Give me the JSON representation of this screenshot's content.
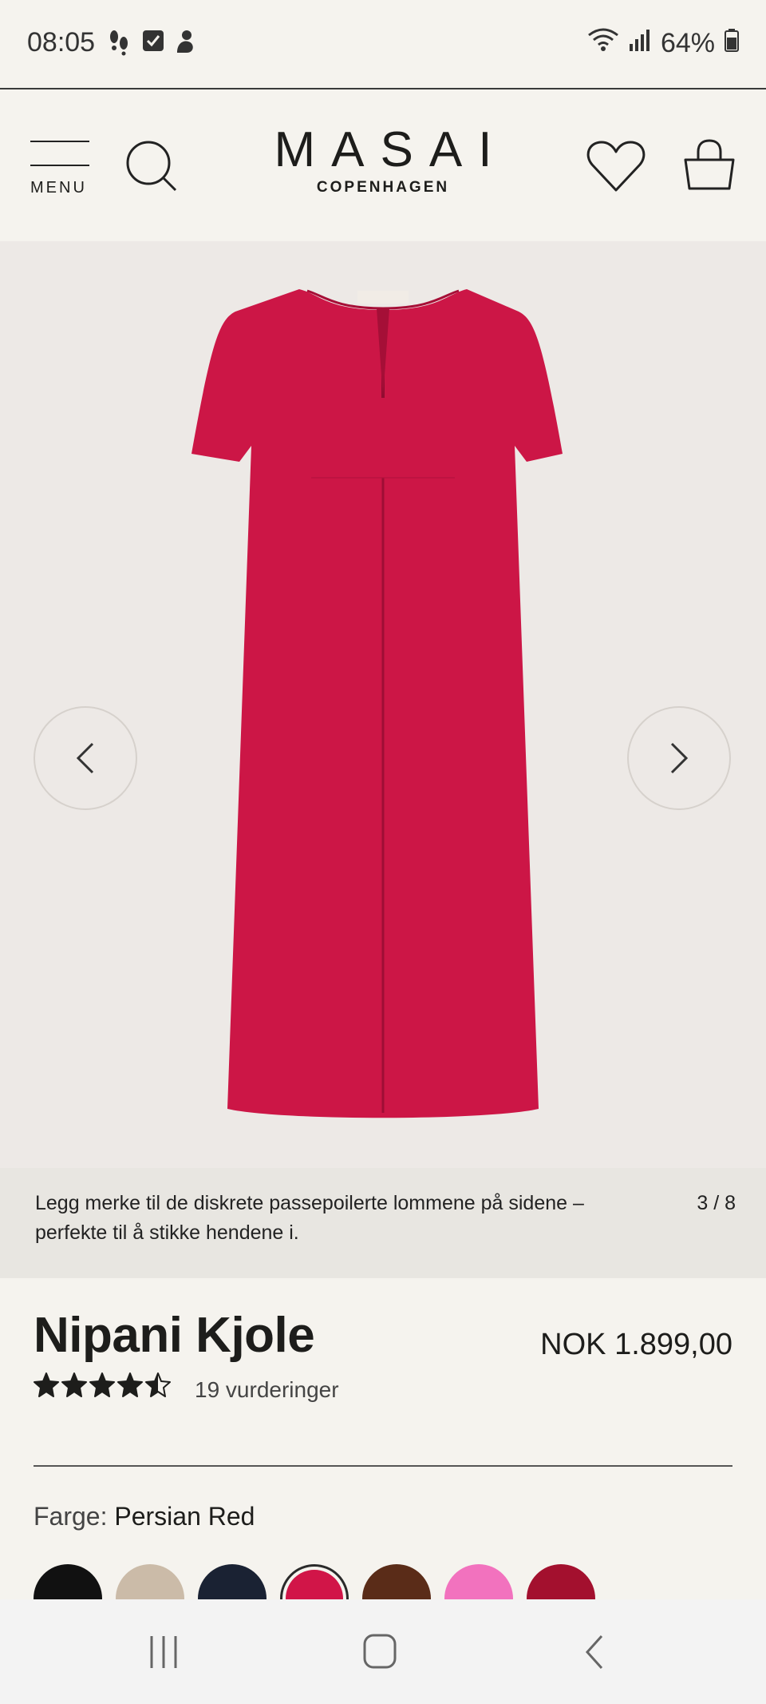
{
  "status_bar": {
    "time": "08:05",
    "battery": "64%"
  },
  "header": {
    "menu_label": "MENU",
    "logo_main": "MASAI",
    "logo_sub": "COPENHAGEN"
  },
  "gallery": {
    "caption": "Legg merke til de diskrete passepoilerte lommene på sidene – perfekte til å stikke hendene i.",
    "counter": "3 / 8",
    "dress_color": "#cc1646"
  },
  "product": {
    "name": "Nipani Kjole",
    "price": "NOK 1.899,00",
    "rating": 4.5,
    "reviews": "19 vurderinger",
    "color_label": "Farge:",
    "color_name": "Persian Red",
    "swatches": [
      {
        "color": "#111111",
        "selected": false
      },
      {
        "color": "#cbbba8",
        "selected": false
      },
      {
        "color": "#1a2233",
        "selected": false
      },
      {
        "color": "#d11548",
        "selected": true
      },
      {
        "color": "#5a2c18",
        "selected": false
      },
      {
        "color": "#f272be",
        "selected": false
      },
      {
        "color": "#a3102e",
        "selected": false
      }
    ]
  },
  "icons": [
    "menu-icon",
    "search-icon",
    "heart-icon",
    "bag-icon",
    "chevron-left-icon",
    "chevron-right-icon",
    "star-icon",
    "recents-icon",
    "home-icon",
    "back-icon"
  ]
}
